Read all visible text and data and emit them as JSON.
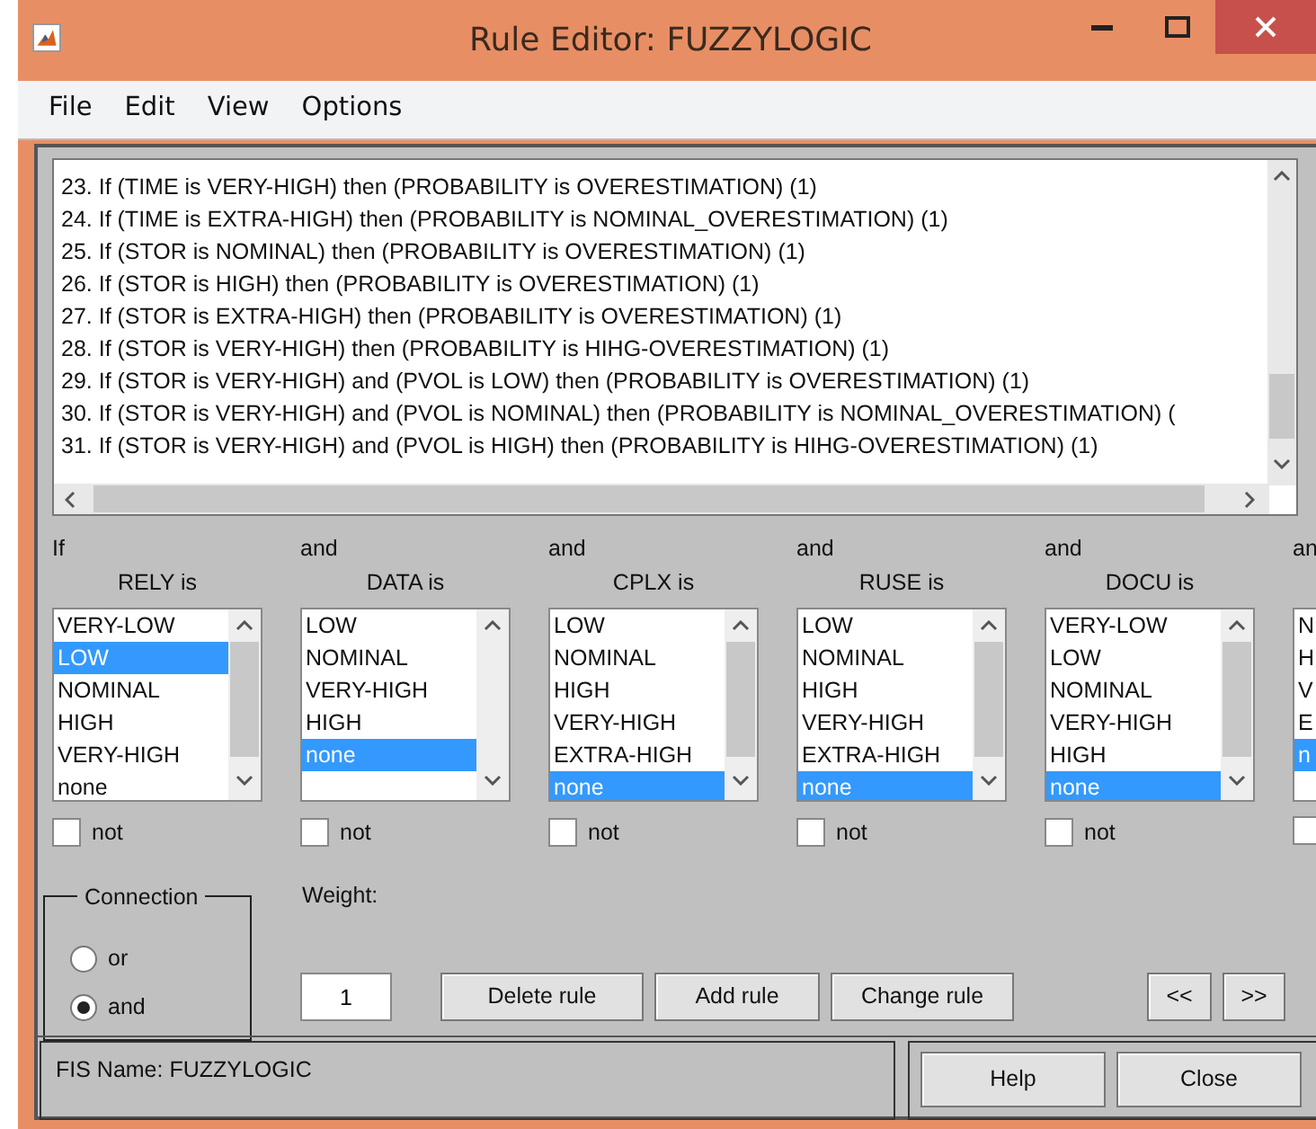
{
  "window": {
    "title": "Rule Editor: FUZZYLOGIC"
  },
  "menu": [
    "File",
    "Edit",
    "View",
    "Options"
  ],
  "rules": [
    "23. If (TIME is VERY-HIGH) then (PROBABILITY is OVERESTIMATION) (1)",
    "24. If (TIME is EXTRA-HIGH) then (PROBABILITY is NOMINAL_OVERESTIMATION) (1)",
    "25. If (STOR is NOMINAL) then (PROBABILITY is OVERESTIMATION) (1)",
    "26. If (STOR is HIGH) then (PROBABILITY is OVERESTIMATION) (1)",
    "27. If (STOR is EXTRA-HIGH) then (PROBABILITY is OVERESTIMATION) (1)",
    "28. If (STOR is VERY-HIGH) then (PROBABILITY is HIHG-OVERESTIMATION) (1)",
    "29. If (STOR is VERY-HIGH) and (PVOL is LOW) then (PROBABILITY is OVERESTIMATION) (1)",
    "30. If (STOR is VERY-HIGH) and (PVOL is NOMINAL) then (PROBABILITY is NOMINAL_OVERESTIMATION) (",
    "31. If (STOR is VERY-HIGH) and (PVOL is HIGH) then (PROBABILITY is HIHG-OVERESTIMATION) (1)"
  ],
  "antecedents": [
    {
      "connector": "If",
      "label": "RELY is",
      "scrollable": true,
      "not": false,
      "not_label": "not",
      "options": [
        {
          "text": "VERY-LOW",
          "selected": false
        },
        {
          "text": "LOW",
          "selected": true
        },
        {
          "text": "NOMINAL",
          "selected": false
        },
        {
          "text": "HIGH",
          "selected": false
        },
        {
          "text": "VERY-HIGH",
          "selected": false
        },
        {
          "text": "none",
          "selected": false
        }
      ]
    },
    {
      "connector": "and",
      "label": "DATA is",
      "scrollable": false,
      "not": false,
      "not_label": "not",
      "options": [
        {
          "text": "LOW",
          "selected": false
        },
        {
          "text": "NOMINAL",
          "selected": false
        },
        {
          "text": "VERY-HIGH",
          "selected": false
        },
        {
          "text": "HIGH",
          "selected": false
        },
        {
          "text": "none",
          "selected": true
        }
      ]
    },
    {
      "connector": "and",
      "label": "CPLX is",
      "scrollable": true,
      "not": false,
      "not_label": "not",
      "options": [
        {
          "text": "LOW",
          "selected": false
        },
        {
          "text": "NOMINAL",
          "selected": false
        },
        {
          "text": "HIGH",
          "selected": false
        },
        {
          "text": "VERY-HIGH",
          "selected": false
        },
        {
          "text": "EXTRA-HIGH",
          "selected": false
        },
        {
          "text": "none",
          "selected": true
        }
      ]
    },
    {
      "connector": "and",
      "label": "RUSE is",
      "scrollable": true,
      "not": false,
      "not_label": "not",
      "options": [
        {
          "text": "LOW",
          "selected": false
        },
        {
          "text": "NOMINAL",
          "selected": false
        },
        {
          "text": "HIGH",
          "selected": false
        },
        {
          "text": "VERY-HIGH",
          "selected": false
        },
        {
          "text": "EXTRA-HIGH",
          "selected": false
        },
        {
          "text": "none",
          "selected": true
        }
      ]
    },
    {
      "connector": "and",
      "label": "DOCU is",
      "scrollable": true,
      "not": false,
      "not_label": "not",
      "options": [
        {
          "text": "VERY-LOW",
          "selected": false
        },
        {
          "text": "LOW",
          "selected": false
        },
        {
          "text": "NOMINAL",
          "selected": false
        },
        {
          "text": "VERY-HIGH",
          "selected": false
        },
        {
          "text": "HIGH",
          "selected": false
        },
        {
          "text": "none",
          "selected": true
        }
      ]
    },
    {
      "connector": "an",
      "not": false,
      "options": [
        {
          "text": "N",
          "selected": false
        },
        {
          "text": "H",
          "selected": false
        },
        {
          "text": "V",
          "selected": false
        },
        {
          "text": "E",
          "selected": false
        },
        {
          "text": "n",
          "selected": true
        }
      ]
    }
  ],
  "connection": {
    "label": "Connection",
    "options": [
      {
        "label": "or",
        "selected": false
      },
      {
        "label": "and",
        "selected": true
      }
    ]
  },
  "weight": {
    "label": "Weight:",
    "value": "1"
  },
  "buttons": [
    "Delete rule",
    "Add rule",
    "Change rule",
    "<<",
    ">>"
  ],
  "status": "FIS Name: FUZZYLOGIC",
  "dialog_buttons": [
    "Help",
    "Close"
  ]
}
